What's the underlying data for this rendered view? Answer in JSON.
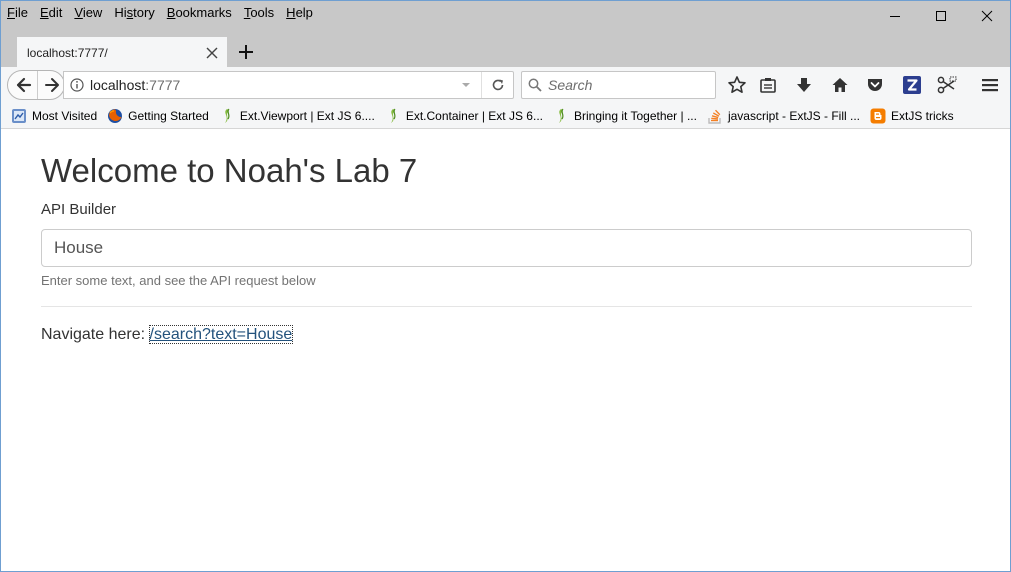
{
  "menu": {
    "items": [
      "File",
      "Edit",
      "View",
      "History",
      "Bookmarks",
      "Tools",
      "Help"
    ]
  },
  "tab": {
    "title": "localhost:7777/"
  },
  "navbar": {
    "url_host": "localhost",
    "url_port": ":7777",
    "search_placeholder": "Search"
  },
  "bookmarks": [
    {
      "label": "Most Visited",
      "icon": "most-visited-icon"
    },
    {
      "label": "Getting Started",
      "icon": "firefox-icon"
    },
    {
      "label": "Ext.Viewport | Ext JS 6....",
      "icon": "sencha-leaf-icon"
    },
    {
      "label": "Ext.Container | Ext JS 6...",
      "icon": "sencha-leaf-icon"
    },
    {
      "label": "Bringing it Together | ...",
      "icon": "sencha-leaf-icon"
    },
    {
      "label": "javascript - ExtJS - Fill ...",
      "icon": "stackoverflow-icon"
    },
    {
      "label": "ExtJS tricks",
      "icon": "blogger-icon"
    }
  ],
  "page": {
    "title": "Welcome to Noah's Lab 7",
    "subtitle": "API Builder",
    "input_value": "House",
    "help_text": "Enter some text, and see the API request below",
    "navigate_prefix": "Navigate here: ",
    "navigate_link": "/search?text=House"
  },
  "colors": {
    "chrome_bg": "#c8c8c8",
    "toolbar_bg": "#f5f6f7",
    "link": "#23527c"
  }
}
